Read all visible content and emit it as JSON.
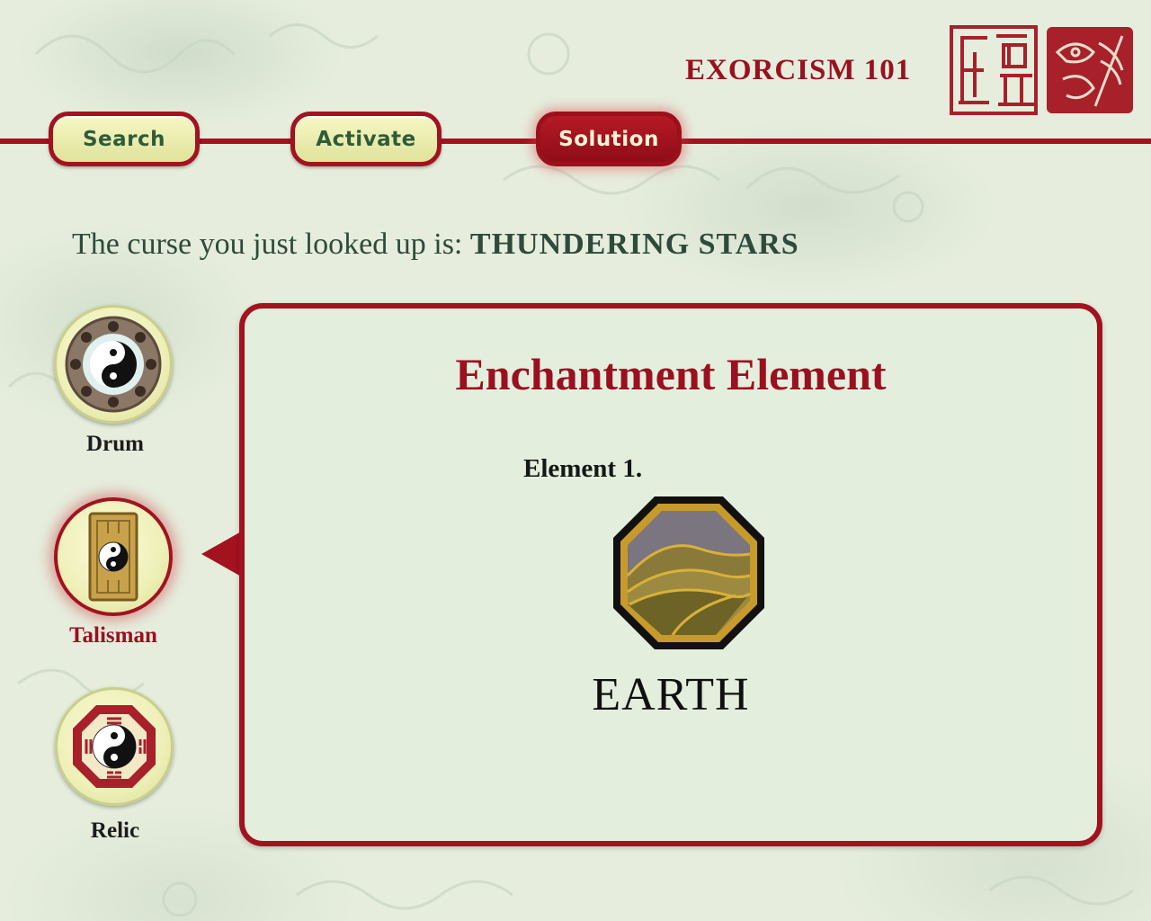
{
  "header": {
    "title": "EXORCISM 101",
    "colors": {
      "accent_red": "#a2121f",
      "dark_green": "#2f5b3a",
      "tab_yellow": "#eef0b0",
      "background": "#e6eddd"
    }
  },
  "tabs": [
    {
      "label": "Search",
      "state": "inactive"
    },
    {
      "label": "Activate",
      "state": "inactive"
    },
    {
      "label": "Solution",
      "state": "active"
    }
  ],
  "curse": {
    "prefix": "The curse you just looked up is:",
    "name": "THUNDERING STARS"
  },
  "tools": [
    {
      "label": "Drum",
      "icon": "drum-yin-yang-icon",
      "selected": false
    },
    {
      "label": "Talisman",
      "icon": "talisman-scroll-icon",
      "selected": true
    },
    {
      "label": "Relic",
      "icon": "bagua-relic-icon",
      "selected": false
    }
  ],
  "panel": {
    "title": "Enchantment Element",
    "element_label": "Element 1.",
    "element_name": "EARTH",
    "element_icon": "earth-hills-icon"
  }
}
